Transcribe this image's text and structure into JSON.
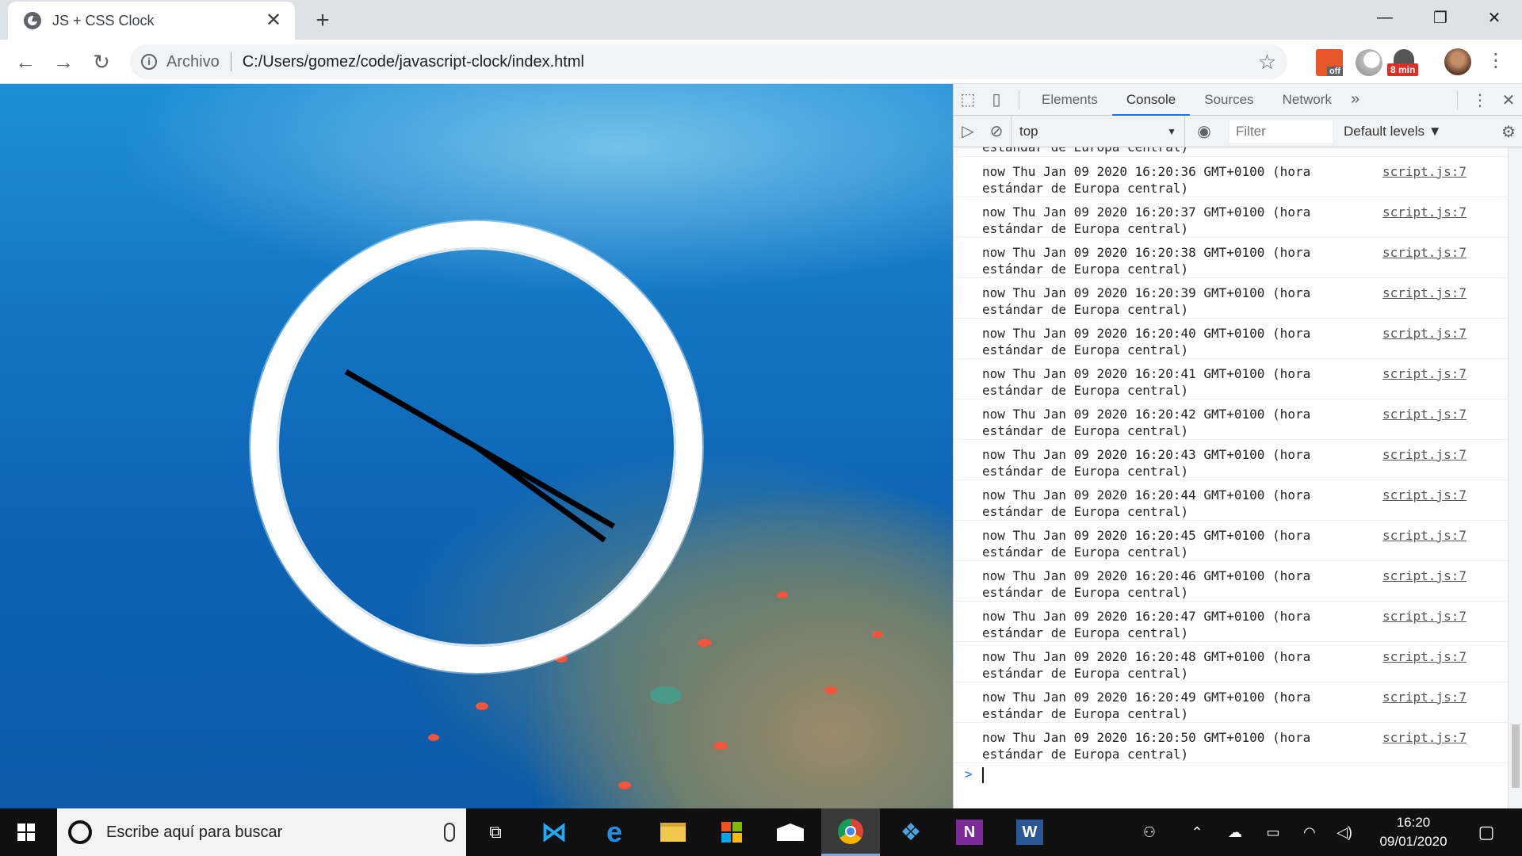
{
  "browser": {
    "tab_title": "JS + CSS Clock",
    "tab_close": "✕",
    "new_tab": "+",
    "window_controls": {
      "minimize": "—",
      "restore": "❐",
      "close": "✕"
    },
    "nav": {
      "back": "←",
      "forward": "→",
      "reload": "↻"
    },
    "address": {
      "chip": "Archivo",
      "url": "C:/Users/gomez/code/javascript-clock/index.html",
      "info": "i",
      "star": "☆"
    },
    "extensions": {
      "office_badge": "off",
      "timer_badge": "8 min"
    },
    "menu": "⋮"
  },
  "clock": {
    "hour_hand_deg": 120,
    "minute_hand_deg": 300,
    "second_hand_deg": 126
  },
  "devtools": {
    "tabs": [
      {
        "label": "Elements",
        "active": false
      },
      {
        "label": "Console",
        "active": true
      },
      {
        "label": "Sources",
        "active": false
      },
      {
        "label": "Network",
        "active": false
      }
    ],
    "more_tabs": "»",
    "kebab": "⋮",
    "close": "✕",
    "context": "top",
    "context_arrow": "▼",
    "filter_placeholder": "Filter",
    "levels": "Default levels ▼",
    "partial_line": "estándar de Europa central)",
    "messages": [
      {
        "line1": "now Thu Jan 09 2020 16:20:36 GMT+0100 (hora",
        "line2": "estándar de Europa central)",
        "source": "script.js:7"
      },
      {
        "line1": "now Thu Jan 09 2020 16:20:37 GMT+0100 (hora",
        "line2": "estándar de Europa central)",
        "source": "script.js:7"
      },
      {
        "line1": "now Thu Jan 09 2020 16:20:38 GMT+0100 (hora",
        "line2": "estándar de Europa central)",
        "source": "script.js:7"
      },
      {
        "line1": "now Thu Jan 09 2020 16:20:39 GMT+0100 (hora",
        "line2": "estándar de Europa central)",
        "source": "script.js:7"
      },
      {
        "line1": "now Thu Jan 09 2020 16:20:40 GMT+0100 (hora",
        "line2": "estándar de Europa central)",
        "source": "script.js:7"
      },
      {
        "line1": "now Thu Jan 09 2020 16:20:41 GMT+0100 (hora",
        "line2": "estándar de Europa central)",
        "source": "script.js:7"
      },
      {
        "line1": "now Thu Jan 09 2020 16:20:42 GMT+0100 (hora",
        "line2": "estándar de Europa central)",
        "source": "script.js:7"
      },
      {
        "line1": "now Thu Jan 09 2020 16:20:43 GMT+0100 (hora",
        "line2": "estándar de Europa central)",
        "source": "script.js:7"
      },
      {
        "line1": "now Thu Jan 09 2020 16:20:44 GMT+0100 (hora",
        "line2": "estándar de Europa central)",
        "source": "script.js:7"
      },
      {
        "line1": "now Thu Jan 09 2020 16:20:45 GMT+0100 (hora",
        "line2": "estándar de Europa central)",
        "source": "script.js:7"
      },
      {
        "line1": "now Thu Jan 09 2020 16:20:46 GMT+0100 (hora",
        "line2": "estándar de Europa central)",
        "source": "script.js:7"
      },
      {
        "line1": "now Thu Jan 09 2020 16:20:47 GMT+0100 (hora",
        "line2": "estándar de Europa central)",
        "source": "script.js:7"
      },
      {
        "line1": "now Thu Jan 09 2020 16:20:48 GMT+0100 (hora",
        "line2": "estándar de Europa central)",
        "source": "script.js:7"
      },
      {
        "line1": "now Thu Jan 09 2020 16:20:49 GMT+0100 (hora",
        "line2": "estándar de Europa central)",
        "source": "script.js:7"
      },
      {
        "line1": "now Thu Jan 09 2020 16:20:50 GMT+0100 (hora",
        "line2": "estándar de Europa central)",
        "source": "script.js:7"
      }
    ],
    "prompt": ">"
  },
  "taskbar": {
    "search_placeholder": "Escribe aquí para buscar",
    "time": "16:20",
    "date": "09/01/2020"
  },
  "colors": {
    "accent": "#1a73e8",
    "water": "#1377c4",
    "taskbar": "#101010"
  }
}
